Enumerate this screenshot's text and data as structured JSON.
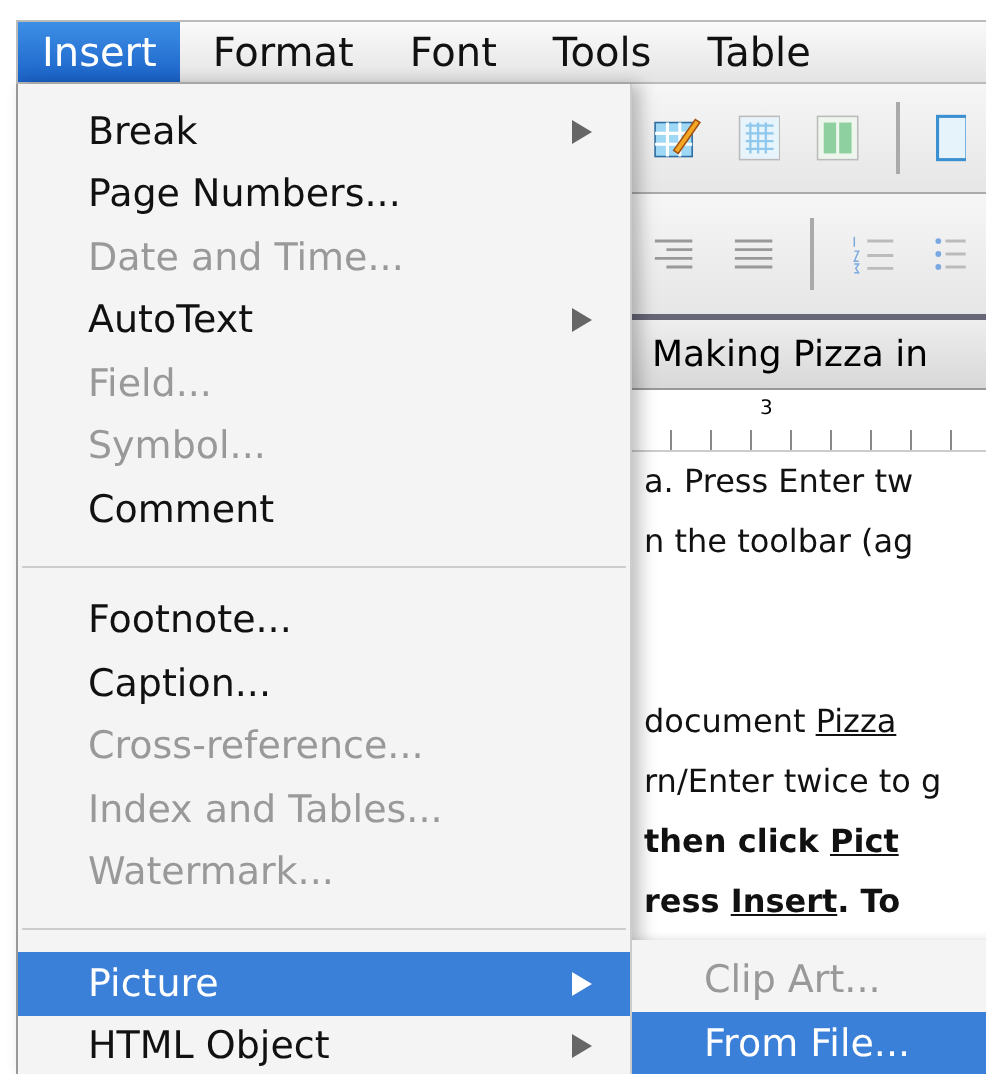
{
  "menubar": [
    {
      "label": "Insert",
      "selected": true
    },
    {
      "label": "Format",
      "selected": false
    },
    {
      "label": "Font",
      "selected": false
    },
    {
      "label": "Tools",
      "selected": false
    },
    {
      "label": "Table",
      "selected": false
    }
  ],
  "menu": [
    {
      "kind": "item",
      "label": "Break",
      "disabled": false,
      "submenu": true,
      "selected": false
    },
    {
      "kind": "item",
      "label": "Page Numbers...",
      "disabled": false,
      "submenu": false,
      "selected": false
    },
    {
      "kind": "item",
      "label": "Date and Time...",
      "disabled": true,
      "submenu": false,
      "selected": false
    },
    {
      "kind": "item",
      "label": "AutoText",
      "disabled": false,
      "submenu": true,
      "selected": false
    },
    {
      "kind": "item",
      "label": "Field...",
      "disabled": true,
      "submenu": false,
      "selected": false
    },
    {
      "kind": "item",
      "label": "Symbol...",
      "disabled": true,
      "submenu": false,
      "selected": false
    },
    {
      "kind": "item",
      "label": "Comment",
      "disabled": false,
      "submenu": false,
      "selected": false
    },
    {
      "kind": "separator"
    },
    {
      "kind": "item",
      "label": "Footnote...",
      "disabled": false,
      "submenu": false,
      "selected": false
    },
    {
      "kind": "item",
      "label": "Caption...",
      "disabled": false,
      "submenu": false,
      "selected": false
    },
    {
      "kind": "item",
      "label": "Cross-reference...",
      "disabled": true,
      "submenu": false,
      "selected": false
    },
    {
      "kind": "item",
      "label": "Index and Tables...",
      "disabled": true,
      "submenu": false,
      "selected": false
    },
    {
      "kind": "item",
      "label": "Watermark...",
      "disabled": true,
      "submenu": false,
      "selected": false
    },
    {
      "kind": "separator"
    },
    {
      "kind": "item",
      "label": "Picture",
      "disabled": false,
      "submenu": true,
      "selected": true
    },
    {
      "kind": "item",
      "label": "HTML Object",
      "disabled": false,
      "submenu": true,
      "selected": false
    }
  ],
  "submenu": [
    {
      "label": "Clip Art...",
      "disabled": true,
      "selected": false
    },
    {
      "label": "From File...",
      "disabled": false,
      "selected": true
    }
  ],
  "document": {
    "title": "Making Pizza in",
    "ruler_number": "3",
    "paragraphs": [
      [
        [
          {
            "text": "a. Press Enter tw",
            "bold": false,
            "underline": false
          }
        ],
        [
          {
            "text": "n the toolbar (ag",
            "bold": false,
            "underline": false
          }
        ]
      ],
      [
        [
          {
            "text": "document ",
            "bold": false,
            "underline": false
          },
          {
            "text": "Pizza",
            "bold": false,
            "underline": true
          }
        ],
        [
          {
            "text": "rn/Enter twice to g",
            "bold": false,
            "underline": false
          }
        ],
        [
          {
            "text": "then click ",
            "bold": true,
            "underline": false
          },
          {
            "text": "Pict",
            "bold": true,
            "underline": true
          }
        ],
        [
          {
            "text": "ress ",
            "bold": true,
            "underline": false
          },
          {
            "text": "Insert",
            "bold": true,
            "underline": true
          },
          {
            "text": ".  To",
            "bold": true,
            "underline": false
          }
        ]
      ]
    ]
  }
}
